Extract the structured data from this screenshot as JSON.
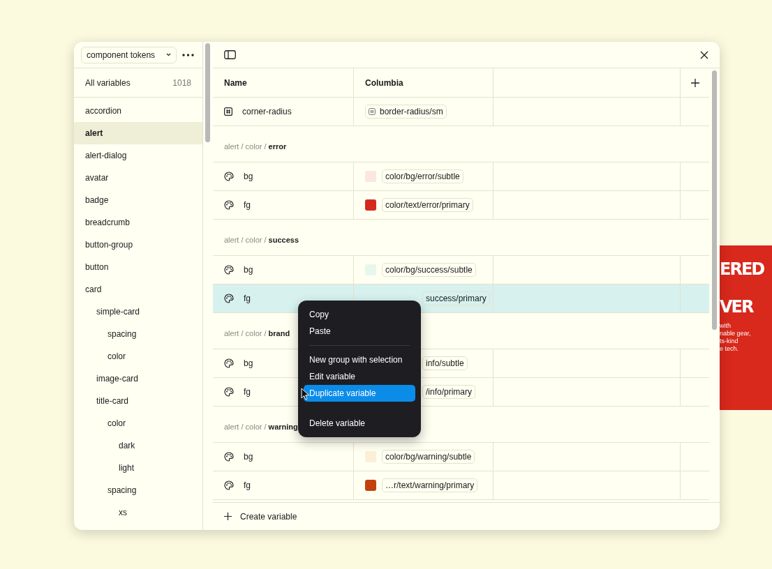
{
  "sidebar": {
    "collection": "component tokens",
    "all_variables": {
      "label": "All variables",
      "count": "1018"
    },
    "items": [
      {
        "label": "accordion",
        "selected": false
      },
      {
        "label": "alert",
        "selected": true
      },
      {
        "label": "alert-dialog",
        "selected": false
      },
      {
        "label": "avatar",
        "selected": false
      },
      {
        "label": "badge",
        "selected": false
      },
      {
        "label": "breadcrumb",
        "selected": false
      },
      {
        "label": "button-group",
        "selected": false
      },
      {
        "label": "button",
        "selected": false
      },
      {
        "label": "card",
        "selected": false,
        "children": [
          {
            "label": "simple-card",
            "selected": false,
            "children": [
              {
                "label": "spacing",
                "selected": false
              },
              {
                "label": "color",
                "selected": false
              }
            ]
          },
          {
            "label": "image-card",
            "selected": false
          },
          {
            "label": "title-card",
            "selected": false,
            "children": [
              {
                "label": "color",
                "selected": false,
                "children": [
                  {
                    "label": "dark",
                    "selected": false
                  },
                  {
                    "label": "light",
                    "selected": false
                  }
                ]
              },
              {
                "label": "spacing",
                "selected": false,
                "children": [
                  {
                    "label": "xs",
                    "selected": false
                  }
                ]
              }
            ]
          }
        ]
      }
    ]
  },
  "table": {
    "columns": [
      "Name",
      "Columbia"
    ],
    "sections": [
      {
        "rows": [
          {
            "kind": "number",
            "name": "corner-radius",
            "value": "border-radius/sm",
            "selected": false
          }
        ]
      },
      {
        "path": "alert / color / **error**",
        "rows": [
          {
            "kind": "color",
            "name": "bg",
            "value": "color/bg/error/subtle",
            "color": "#fbe6e3",
            "selected": false
          },
          {
            "kind": "color",
            "name": "fg",
            "value": "color/text/error/primary",
            "color": "#d42a1e",
            "selected": false
          }
        ]
      },
      {
        "path": "alert / color / **success**",
        "rows": [
          {
            "kind": "color",
            "name": "bg",
            "value": "color/bg/success/subtle",
            "color": "#e6f7ec",
            "selected": false
          },
          {
            "kind": "color",
            "name": "fg",
            "value": "success/primary",
            "selected": true,
            "partial": true
          }
        ]
      },
      {
        "path": "alert / color / **brand**",
        "rows": [
          {
            "kind": "color",
            "name": "bg",
            "value": "info/subtle",
            "selected": false,
            "partial": true
          },
          {
            "kind": "color",
            "name": "fg",
            "value": "/info/primary",
            "selected": false,
            "partial": true
          }
        ]
      },
      {
        "path": "alert / color / **warning**",
        "rows": [
          {
            "kind": "color",
            "name": "bg",
            "value": "color/bg/warning/subtle",
            "color": "#fcefd6",
            "selected": false
          },
          {
            "kind": "color",
            "name": "fg",
            "value": "…r/text/warning/primary",
            "color": "#c2410c",
            "selected": false
          }
        ]
      }
    ],
    "create_label": "Create variable"
  },
  "context_menu": {
    "groups": [
      [
        {
          "label": "Copy",
          "selected": false
        },
        {
          "label": "Paste",
          "selected": false
        }
      ],
      [
        {
          "label": "New group with selection",
          "selected": false
        },
        {
          "label": "Edit variable",
          "selected": false
        },
        {
          "label": "Duplicate variable",
          "selected": true
        }
      ],
      [
        {
          "label": "Delete variable",
          "selected": false
        }
      ]
    ]
  },
  "background_banner": {
    "heading_lines": [
      "ERED",
      "VER"
    ],
    "body_lines": [
      "with",
      "nable gear,",
      "ts-kind",
      "e tech."
    ]
  }
}
